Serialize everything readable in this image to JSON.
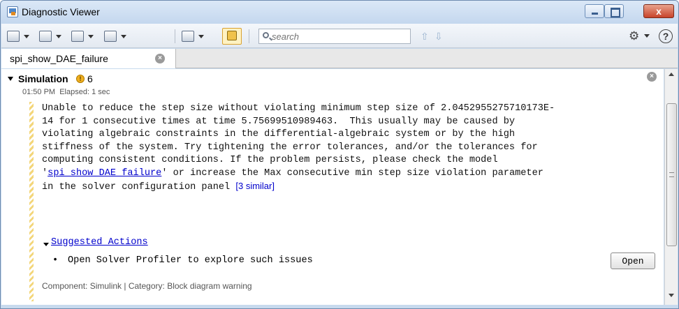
{
  "window": {
    "title": "Diagnostic Viewer",
    "close_glyph": "x"
  },
  "toolbar": {
    "search_placeholder": "search",
    "up_arrow": "⇧",
    "down_arrow": "⇩",
    "gear_glyph": "⚙",
    "help_glyph": "?"
  },
  "tabs": [
    {
      "label": "spi_show_DAE_failure",
      "close_glyph": "×"
    }
  ],
  "section": {
    "title": "Simulation",
    "warning_glyph": "!",
    "warning_count": "6",
    "time": "01:50 PM",
    "elapsed": "Elapsed: 1 sec",
    "close_glyph": "×"
  },
  "message": {
    "line1": "Unable to reduce the step size without violating minimum step size of 2.0452955275710173E-",
    "line2": "14 for 1 consecutive times at time 5.75699510989463.  This usually may be caused by",
    "line3": "violating algebraic constraints in the differential-algebraic system or by the high",
    "line4": "stiffness of the system. Try tightening the error tolerances, and/or the tolerances for",
    "line5": "computing consistent conditions. If the problem persists, please check the model",
    "line6_pre": "'",
    "line6_link": "spi_show_DAE_failure",
    "line6_post": "' or increase the Max consecutive min step size violation parameter",
    "line7": "in the solver configuration panel ",
    "similar_link": "[3 similar]"
  },
  "suggested": {
    "title": "Suggested Actions",
    "bullet": "•",
    "action": "Open Solver Profiler to explore such issues",
    "button": "Open"
  },
  "footer": {
    "component": "Component: Simulink | Category: Block diagram warning"
  }
}
